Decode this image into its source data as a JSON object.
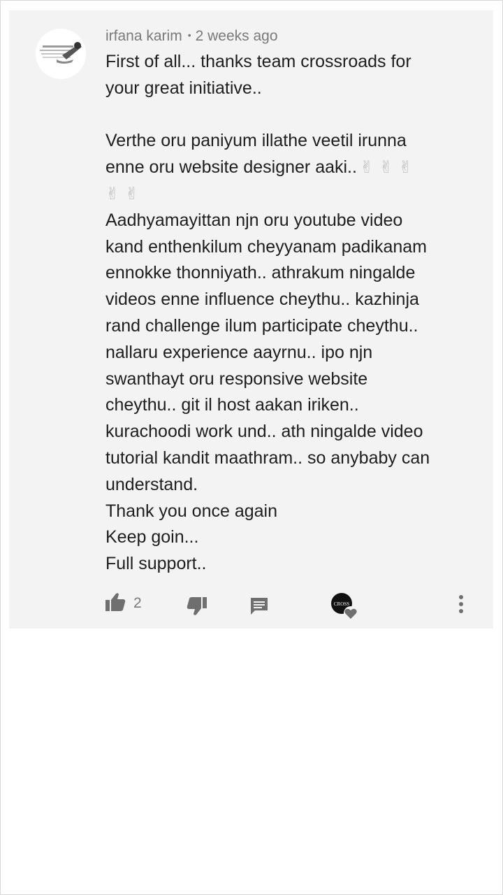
{
  "comment": {
    "author": "irfana karim",
    "separator": "•",
    "time": "2 weeks ago",
    "paragraph_1": "First of all... thanks team crossroads for\nyour great initiative..",
    "paragraph_2a": "Verthe oru paniyum illathe veetil irunna\nenne oru website designer aaki..",
    "emojis_line1": "✌ ✌ ✌",
    "emojis_line2": "✌ ✌",
    "paragraph_3": "Aadhyamayittan njn oru youtube video\nkand enthenkilum cheyyanam padikanam\nennokke thonniyath.. athrakum ningalde\nvideos enne influence cheythu.. kazhinja\nrand challenge ilum participate cheythu..\nnallaru experience aayrnu..  ipo njn\nswanthayt oru responsive website\ncheythu..  git il host aakan iriken..\nkurachoodi work und.. ath ningalde video\ntutorial kandit maathram..  so anybaby can\nunderstand.",
    "line_thanks": "Thank you once again",
    "line_keep": "Keep goin...",
    "line_support": "Full support.."
  },
  "actions": {
    "like_count": "2",
    "like_icon": "thumbs-up-icon",
    "dislike_icon": "thumbs-down-icon",
    "reply_icon": "reply-icon",
    "creator_heart_icon": "creator-heart-icon",
    "creator_badge_text": "CROSS",
    "more_icon": "more-vertical-icon"
  },
  "colors": {
    "card_background": "#f3f3f3",
    "text": "#1e1e1e",
    "meta_text": "#7a7a7a",
    "icon": "#6f6f6f"
  }
}
